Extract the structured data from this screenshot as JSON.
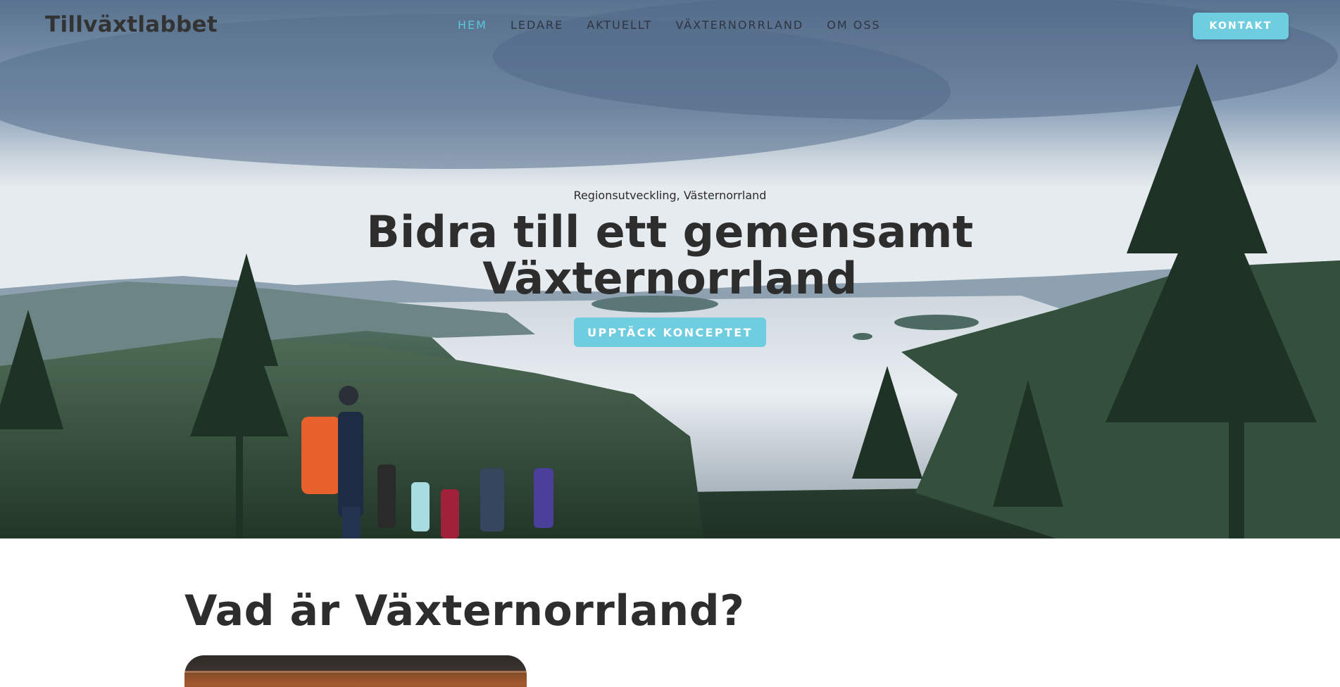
{
  "brand": {
    "logo_text": "Tillväxtlabbet"
  },
  "nav": {
    "items": [
      {
        "label": "HEM",
        "active": true
      },
      {
        "label": "LEDARE",
        "active": false
      },
      {
        "label": "AKTUELLT",
        "active": false
      },
      {
        "label": "VÄXTERNORRLAND",
        "active": false
      },
      {
        "label": "OM OSS",
        "active": false
      }
    ],
    "contact_button": "KONTAKT"
  },
  "hero": {
    "eyebrow": "Regionsutveckling, Västernorrland",
    "headline": "Bidra till ett gemensamt Växternorrland",
    "cta_label": "UPPTÄCK KONCEPTET",
    "image_description_icon": "landscape-photo"
  },
  "section": {
    "title": "Vad är Växternorrland?"
  },
  "colors": {
    "accent": "#6fcde0",
    "active_nav": "#5cc6d8",
    "text_dark": "#2d2d2d",
    "background": "#ffffff"
  }
}
